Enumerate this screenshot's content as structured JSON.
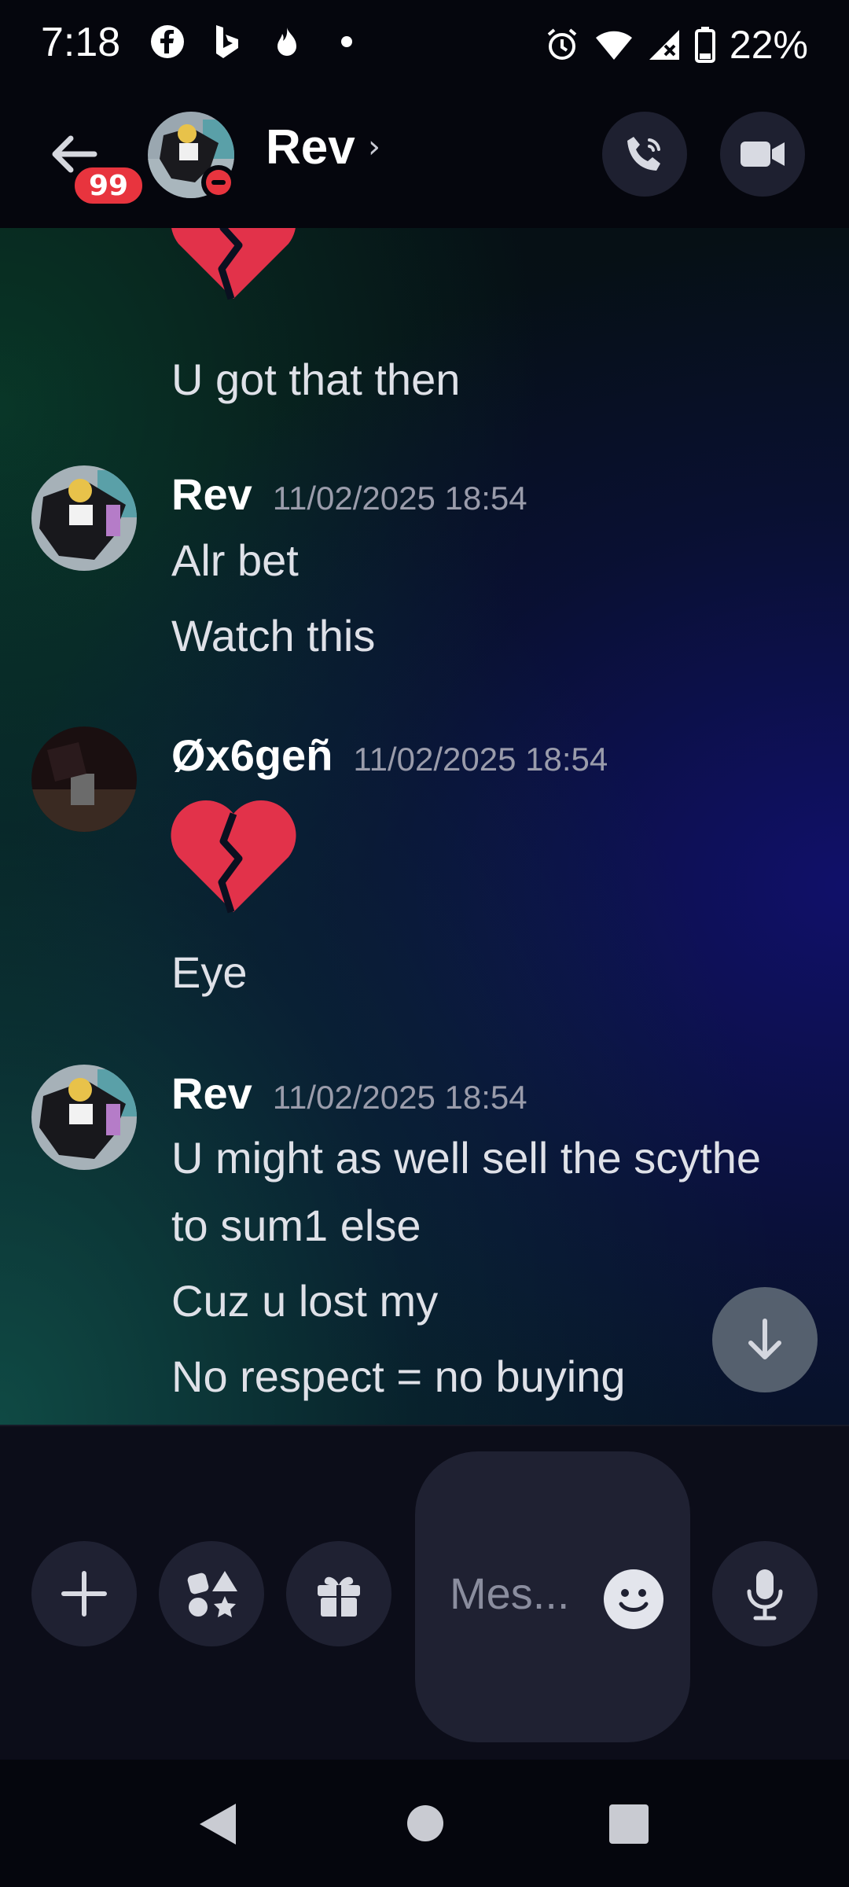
{
  "status_bar": {
    "time": "7:18",
    "battery": "22%",
    "left_icons": [
      "facebook-icon",
      "bing-icon",
      "flame-icon",
      "dot-icon"
    ],
    "right_icons": [
      "alarm-icon",
      "wifi-icon",
      "signal-icon",
      "battery-icon"
    ]
  },
  "header": {
    "unread_badge": "99",
    "contact_name": "Rev",
    "chevron": "›",
    "status": "do-not-disturb",
    "actions": [
      "call-icon",
      "video-icon"
    ]
  },
  "messages": [
    {
      "type": "continuation",
      "emoji": "broken-heart",
      "text": "U got that then"
    },
    {
      "author": "Rev",
      "timestamp": "11/02/2025 18:54",
      "lines": [
        "Alr bet",
        "Watch this"
      ]
    },
    {
      "author": "Øx6geñ",
      "timestamp": "11/02/2025 18:54",
      "emoji": "broken-heart",
      "lines": [
        "Eye"
      ]
    },
    {
      "author": "Rev",
      "timestamp": "11/02/2025 18:54",
      "lines": [
        "U might as well sell the scythe",
        "to sum1 else",
        "Cuz u lost my",
        "No respect = no buying"
      ]
    }
  ],
  "composer": {
    "placeholder": "Mes...",
    "buttons": [
      "plus-icon",
      "apps-icon",
      "gift-icon",
      "emoji-icon",
      "mic-icon"
    ]
  },
  "colors": {
    "accent_red": "#e8343e",
    "background": "#05060d",
    "button_bg": "#1f2132"
  }
}
